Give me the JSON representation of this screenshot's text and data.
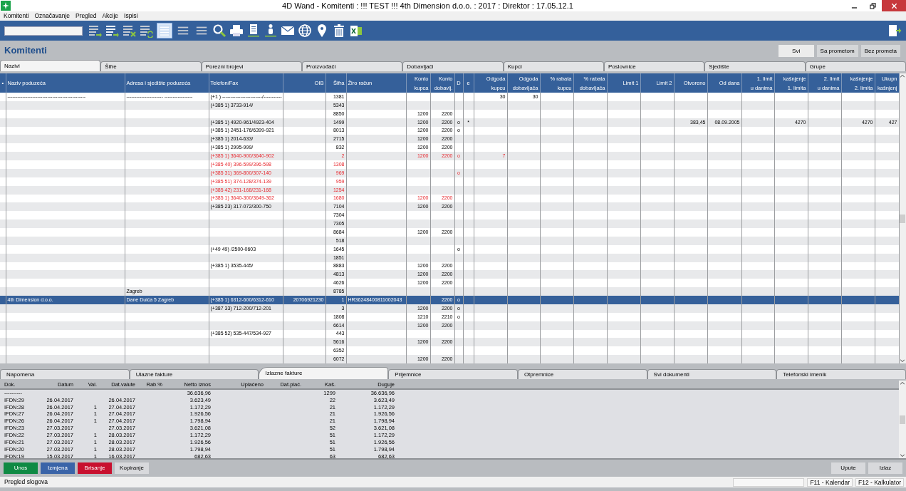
{
  "window": {
    "title": "4D Wand - Komitenti : !!! TEST !!! 4th Dimension d.o.o. : 2017 : Direktor : 17.05.12.1"
  },
  "menu": [
    "Komitenti",
    "Označavanje",
    "Pregled",
    "Akcije",
    "Ispisi"
  ],
  "toolbar": {
    "view_buttons": [
      {
        "selected": true
      },
      {
        "selected": false
      },
      {
        "selected": false
      }
    ]
  },
  "page_title": "Komitenti",
  "filters": [
    {
      "label": "Svi",
      "selected": true
    },
    {
      "label": "Sa prometom",
      "selected": false
    },
    {
      "label": "Bez prometa",
      "selected": false
    }
  ],
  "tabs": [
    {
      "label": "Nazivi",
      "selected": true
    },
    {
      "label": "Šifre",
      "selected": false
    },
    {
      "label": "Porezni brojevi",
      "selected": false
    },
    {
      "label": "Proizvođači",
      "selected": false
    },
    {
      "label": "Dobavljači",
      "selected": false
    },
    {
      "label": "Kupci",
      "selected": false
    },
    {
      "label": "Poslovnice",
      "selected": false
    },
    {
      "label": "Sjedište",
      "selected": false
    },
    {
      "label": "Grupe",
      "selected": false
    }
  ],
  "table": {
    "columns": [
      {
        "label": "•",
        "kind": "flag"
      },
      {
        "label": "Naziv poduzeća",
        "kind": "text"
      },
      {
        "label": "Adresa i sjedište poduzeća",
        "kind": "text"
      },
      {
        "label": "Telefon/Fax",
        "kind": "text"
      },
      {
        "label": "OIB",
        "kind": "number"
      },
      {
        "label": "Šifra",
        "kind": "number"
      },
      {
        "label": "Žiro račun",
        "kind": "text"
      },
      {
        "label": "Konto\nkupca",
        "kind": "number"
      },
      {
        "label": "Konto\ndobavlj.",
        "kind": "number"
      },
      {
        "label": "D",
        "kind": "flag"
      },
      {
        "label": "e",
        "kind": "flag"
      },
      {
        "label": "Odgoda\nkupcu",
        "kind": "number"
      },
      {
        "label": "Odgoda\ndobavljača",
        "kind": "number"
      },
      {
        "label": "% rabata\nkupcu",
        "kind": "number"
      },
      {
        "label": "% rabata\ndobavljača",
        "kind": "number"
      },
      {
        "label": "Limit 1",
        "kind": "number"
      },
      {
        "label": "Limit 2",
        "kind": "number"
      },
      {
        "label": "Otvoreno",
        "kind": "number"
      },
      {
        "label": "Od dana",
        "kind": "number"
      },
      {
        "label": "1. limit\nu danima",
        "kind": "number"
      },
      {
        "label": "kašnjenje\n1. limita",
        "kind": "number"
      },
      {
        "label": "2. limit\nu danima",
        "kind": "number"
      },
      {
        "label": "kašnjenje\n2. limita",
        "kind": "number"
      },
      {
        "label": "Ukupn\nkašnjenj",
        "kind": "number"
      }
    ],
    "rows": [
      {
        "selected": false,
        "flagged": false,
        "cells": [
          null,
          "-----------------------------------------------",
          "----------------------  -----------------",
          "(+1 ) ------------------------/-----------",
          null,
          "1381",
          null,
          null,
          null,
          null,
          null,
          "30",
          "30"
        ]
      },
      {
        "selected": false,
        "flagged": false,
        "cells": [
          null,
          null,
          null,
          "(+385 1) 3733-914/",
          null,
          "5343"
        ]
      },
      {
        "selected": false,
        "flagged": false,
        "cells": [
          null,
          null,
          null,
          null,
          null,
          "8850",
          null,
          "1200",
          "2200"
        ]
      },
      {
        "selected": false,
        "flagged": false,
        "cells": [
          null,
          null,
          null,
          "(+385 1) 4920-961/4923-404",
          null,
          "1499",
          null,
          "1200",
          "2200",
          "o",
          "*",
          null,
          null,
          null,
          null,
          null,
          null,
          "383,45",
          "08.09.2005",
          null,
          "4270",
          null,
          "4270",
          "427"
        ]
      },
      {
        "selected": false,
        "flagged": false,
        "cells": [
          null,
          null,
          null,
          "(+385 1) 2451-176/6399-921",
          null,
          "8013",
          null,
          "1200",
          "2200",
          "o"
        ]
      },
      {
        "selected": false,
        "flagged": false,
        "cells": [
          null,
          null,
          null,
          "(+385 1) 2014-633/",
          null,
          "2715",
          null,
          "1200",
          "2200"
        ]
      },
      {
        "selected": false,
        "flagged": false,
        "cells": [
          null,
          null,
          null,
          "(+385 1) 2995-999/",
          null,
          "832",
          null,
          "1200",
          "2200"
        ]
      },
      {
        "selected": false,
        "flagged": true,
        "cells": [
          null,
          null,
          null,
          "(+385 1) 3640-900/3640-902",
          null,
          "2",
          null,
          "1200",
          "2200",
          "o",
          null,
          "7"
        ]
      },
      {
        "selected": false,
        "flagged": true,
        "cells": [
          null,
          null,
          null,
          "(+385 40) 396-599/396-598",
          null,
          "1308"
        ]
      },
      {
        "selected": false,
        "flagged": true,
        "cells": [
          null,
          null,
          null,
          "(+385 31) 369-800/307-140",
          null,
          "969",
          null,
          null,
          null,
          "o"
        ]
      },
      {
        "selected": false,
        "flagged": true,
        "cells": [
          null,
          null,
          null,
          "(+385 51) 374-128/374-139",
          null,
          "959"
        ]
      },
      {
        "selected": false,
        "flagged": true,
        "cells": [
          null,
          null,
          null,
          "(+385 42) 231-168/231-168",
          null,
          "1254"
        ]
      },
      {
        "selected": false,
        "flagged": true,
        "cells": [
          null,
          null,
          null,
          "(+385 1) 3640-300/3649-362",
          null,
          "1680",
          null,
          "1200",
          "2200"
        ]
      },
      {
        "selected": false,
        "flagged": false,
        "cells": [
          null,
          null,
          null,
          "(+385 23) 317-072/300-750",
          null,
          "7104",
          null,
          "1200",
          "2200"
        ]
      },
      {
        "selected": false,
        "flagged": false,
        "cells": [
          null,
          null,
          null,
          null,
          null,
          "7304"
        ]
      },
      {
        "selected": false,
        "flagged": false,
        "cells": [
          null,
          null,
          null,
          null,
          null,
          "7305"
        ]
      },
      {
        "selected": false,
        "flagged": false,
        "cells": [
          null,
          null,
          null,
          null,
          null,
          "8684",
          null,
          "1200",
          "2200"
        ]
      },
      {
        "selected": false,
        "flagged": false,
        "cells": [
          null,
          null,
          null,
          null,
          null,
          "518"
        ]
      },
      {
        "selected": false,
        "flagged": false,
        "cells": [
          null,
          null,
          null,
          "(+49 49) /2500-0603",
          null,
          "1645",
          null,
          null,
          null,
          "o"
        ]
      },
      {
        "selected": false,
        "flagged": false,
        "cells": [
          null,
          null,
          null,
          null,
          null,
          "1851"
        ]
      },
      {
        "selected": false,
        "flagged": false,
        "cells": [
          null,
          null,
          null,
          "(+385 1) 3535-445/",
          null,
          "8883",
          null,
          "1200",
          "2200"
        ]
      },
      {
        "selected": false,
        "flagged": false,
        "cells": [
          null,
          null,
          null,
          null,
          null,
          "4813",
          null,
          "1200",
          "2200"
        ]
      },
      {
        "selected": false,
        "flagged": false,
        "cells": [
          null,
          null,
          null,
          null,
          null,
          "4626",
          null,
          "1200",
          "2200"
        ]
      },
      {
        "selected": false,
        "flagged": false,
        "cells": [
          null,
          null,
          "Zagreb",
          null,
          null,
          "8785"
        ]
      },
      {
        "selected": true,
        "flagged": false,
        "cells": [
          null,
          "4th Dimension d.o.o.",
          "Dane Duića 5  Zagreb",
          "(+385 1) 6312-600/6312-610",
          "20706921230",
          "1",
          "HR36248400811002043",
          null,
          "2200",
          "o"
        ]
      },
      {
        "selected": false,
        "flagged": false,
        "cells": [
          null,
          null,
          null,
          "(+387 33) 712-200/712-201",
          null,
          "3",
          null,
          "1200",
          "2200",
          "o"
        ]
      },
      {
        "selected": false,
        "flagged": false,
        "cells": [
          null,
          null,
          null,
          null,
          null,
          "1808",
          null,
          "1210",
          "2210",
          "o"
        ]
      },
      {
        "selected": false,
        "flagged": false,
        "cells": [
          null,
          null,
          null,
          null,
          null,
          "6614",
          null,
          "1200",
          "2200"
        ]
      },
      {
        "selected": false,
        "flagged": false,
        "cells": [
          null,
          null,
          null,
          "(+385 52) 535-447/534-927",
          null,
          "443"
        ]
      },
      {
        "selected": false,
        "flagged": false,
        "cells": [
          null,
          null,
          null,
          null,
          null,
          "5616",
          null,
          "1200",
          "2200"
        ]
      },
      {
        "selected": false,
        "flagged": false,
        "cells": [
          null,
          null,
          null,
          null,
          null,
          "6352"
        ]
      },
      {
        "selected": false,
        "flagged": false,
        "cells": [
          null,
          null,
          null,
          null,
          null,
          "6072",
          null,
          "1200",
          "2200"
        ]
      }
    ]
  },
  "detail_tabs": [
    {
      "label": "Napomena",
      "selected": false
    },
    {
      "label": "Ulazne fakture",
      "selected": false
    },
    {
      "label": "Izlazne fakture",
      "selected": true
    },
    {
      "label": "Prijemnice",
      "selected": false
    },
    {
      "label": "Otpremnice",
      "selected": false
    },
    {
      "label": "Svi dokumenti",
      "selected": false
    },
    {
      "label": "Telefonski imenik",
      "selected": false
    }
  ],
  "detail_table": {
    "columns": [
      {
        "label": "Dok.",
        "kind": "text"
      },
      {
        "label": "Datum",
        "kind": "number"
      },
      {
        "label": "Val.",
        "kind": "number"
      },
      {
        "label": "Dat.valute",
        "kind": "number"
      },
      {
        "label": "Rab.%",
        "kind": "number"
      },
      {
        "label": "Netto iznos",
        "kind": "number"
      },
      {
        "label": "Uplaćeno",
        "kind": "number"
      },
      {
        "label": "Dat.plać.",
        "kind": "number"
      },
      {
        "label": "Kaš.",
        "kind": "number"
      },
      {
        "label": "Duguje",
        "kind": "number"
      }
    ],
    "rows": [
      [
        "----------",
        null,
        null,
        null,
        null,
        "36.636,96",
        null,
        null,
        "1299",
        "36.636,96"
      ],
      [
        "IFDN:29",
        "26.04.2017",
        null,
        "26.04.2017",
        null,
        "3.623,49",
        null,
        null,
        "22",
        "3.623,49"
      ],
      [
        "IFDN:28",
        "26.04.2017",
        "1",
        "27.04.2017",
        null,
        "1.172,29",
        null,
        null,
        "21",
        "1.172,29"
      ],
      [
        "IFDN:27",
        "26.04.2017",
        "1",
        "27.04.2017",
        null,
        "1.926,56",
        null,
        null,
        "21",
        "1.926,56"
      ],
      [
        "IFDN:26",
        "26.04.2017",
        "1",
        "27.04.2017",
        null,
        "1.798,94",
        null,
        null,
        "21",
        "1.798,94"
      ],
      [
        "IFDN:23",
        "27.03.2017",
        null,
        "27.03.2017",
        null,
        "3.621,08",
        null,
        null,
        "52",
        "3.621,08"
      ],
      [
        "IFDN:22",
        "27.03.2017",
        "1",
        "28.03.2017",
        null,
        "1.172,29",
        null,
        null,
        "51",
        "1.172,29"
      ],
      [
        "IFDN:21",
        "27.03.2017",
        "1",
        "28.03.2017",
        null,
        "1.926,56",
        null,
        null,
        "51",
        "1.926,56"
      ],
      [
        "IFDN:20",
        "27.03.2017",
        "1",
        "28.03.2017",
        null,
        "1.798,94",
        null,
        null,
        "51",
        "1.798,94"
      ],
      [
        "IFDN:19",
        "15.03.2017",
        "1",
        "16.03.2017",
        null,
        "682,63",
        null,
        null,
        "63",
        "682,63"
      ]
    ]
  },
  "buttons": [
    {
      "label": "Unos",
      "kind": "add"
    },
    {
      "label": "Izmjena",
      "kind": "edit"
    },
    {
      "label": "Brisanje",
      "kind": "delete"
    },
    {
      "label": "Kopiranje",
      "kind": "plain"
    }
  ],
  "footer_buttons": [
    "Upute",
    "Izlaz"
  ],
  "status_bar": [
    "Pregled slogova",
    "F11 - Kalendar",
    "F12 - Kalkulator"
  ]
}
